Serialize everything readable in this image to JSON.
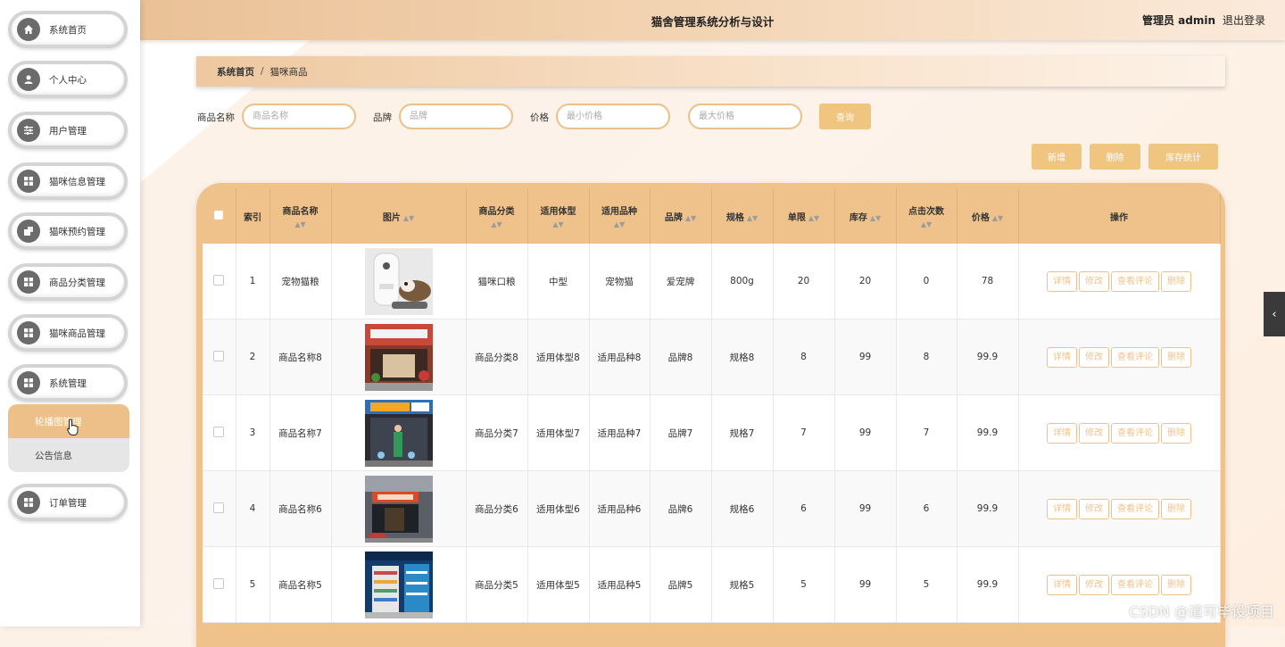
{
  "header": {
    "title": "猫舍管理系统分析与设计",
    "user": "管理员 admin",
    "logout": "退出登录"
  },
  "sidebar": {
    "items": [
      {
        "label": "系统首页",
        "icon": "home-icon"
      },
      {
        "label": "个人中心",
        "icon": "user-icon"
      },
      {
        "label": "用户管理",
        "icon": "sliders-icon"
      },
      {
        "label": "猫咪信息管理",
        "icon": "grid-icon"
      },
      {
        "label": "猫咪预约管理",
        "icon": "calendar-icon"
      },
      {
        "label": "商品分类管理",
        "icon": "grid-icon"
      },
      {
        "label": "猫咪商品管理",
        "icon": "grid-icon"
      },
      {
        "label": "系统管理",
        "icon": "grid-icon"
      }
    ],
    "sub_items": [
      {
        "label": "轮播图管理"
      },
      {
        "label": "公告信息"
      }
    ],
    "last_item": {
      "label": "订单管理",
      "icon": "grid-icon"
    }
  },
  "breadcrumb": {
    "home": "系统首页",
    "sep": "/",
    "current": "猫咪商品"
  },
  "search": {
    "name_label": "商品名称",
    "name_placeholder": "商品名称",
    "brand_label": "品牌",
    "brand_placeholder": "品牌",
    "price_label": "价格",
    "min_placeholder": "最小价格",
    "max_placeholder": "最大价格",
    "query_button": "查询"
  },
  "actions": {
    "add": "新增",
    "delete": "删除",
    "stock": "库存统计"
  },
  "table": {
    "headers": [
      "索引",
      "商品名称",
      "图片",
      "商品分类",
      "适用体型",
      "适用品种",
      "品牌",
      "规格",
      "单限",
      "库存",
      "点击次数",
      "价格",
      "操作"
    ],
    "row_actions": [
      "详情",
      "修改",
      "查看评论",
      "删除"
    ],
    "rows": [
      {
        "index": "1",
        "name": "宠物猫粮",
        "category": "猫咪口粮",
        "size": "中型",
        "breed": "宠物猫",
        "brand": "爱宠牌",
        "spec": "800g",
        "limit": "20",
        "stock": "20",
        "clicks": "0",
        "price": "78"
      },
      {
        "index": "2",
        "name": "商品名称8",
        "category": "商品分类8",
        "size": "适用体型8",
        "breed": "适用品种8",
        "brand": "品牌8",
        "spec": "规格8",
        "limit": "8",
        "stock": "99",
        "clicks": "8",
        "price": "99.9"
      },
      {
        "index": "3",
        "name": "商品名称7",
        "category": "商品分类7",
        "size": "适用体型7",
        "breed": "适用品种7",
        "brand": "品牌7",
        "spec": "规格7",
        "limit": "7",
        "stock": "99",
        "clicks": "7",
        "price": "99.9"
      },
      {
        "index": "4",
        "name": "商品名称6",
        "category": "商品分类6",
        "size": "适用体型6",
        "breed": "适用品种6",
        "brand": "品牌6",
        "spec": "规格6",
        "limit": "6",
        "stock": "99",
        "clicks": "6",
        "price": "99.9"
      },
      {
        "index": "5",
        "name": "商品名称5",
        "category": "商品分类5",
        "size": "适用体型5",
        "breed": "适用品种5",
        "brand": "品牌5",
        "spec": "规格5",
        "limit": "5",
        "stock": "99",
        "clicks": "5",
        "price": "99.9"
      }
    ]
  },
  "watermark": "CSDN @道可毕设项目",
  "colors": {
    "accent": "#f0c580",
    "header_start": "#eac197",
    "nav_icon": "#6b6b6b"
  }
}
